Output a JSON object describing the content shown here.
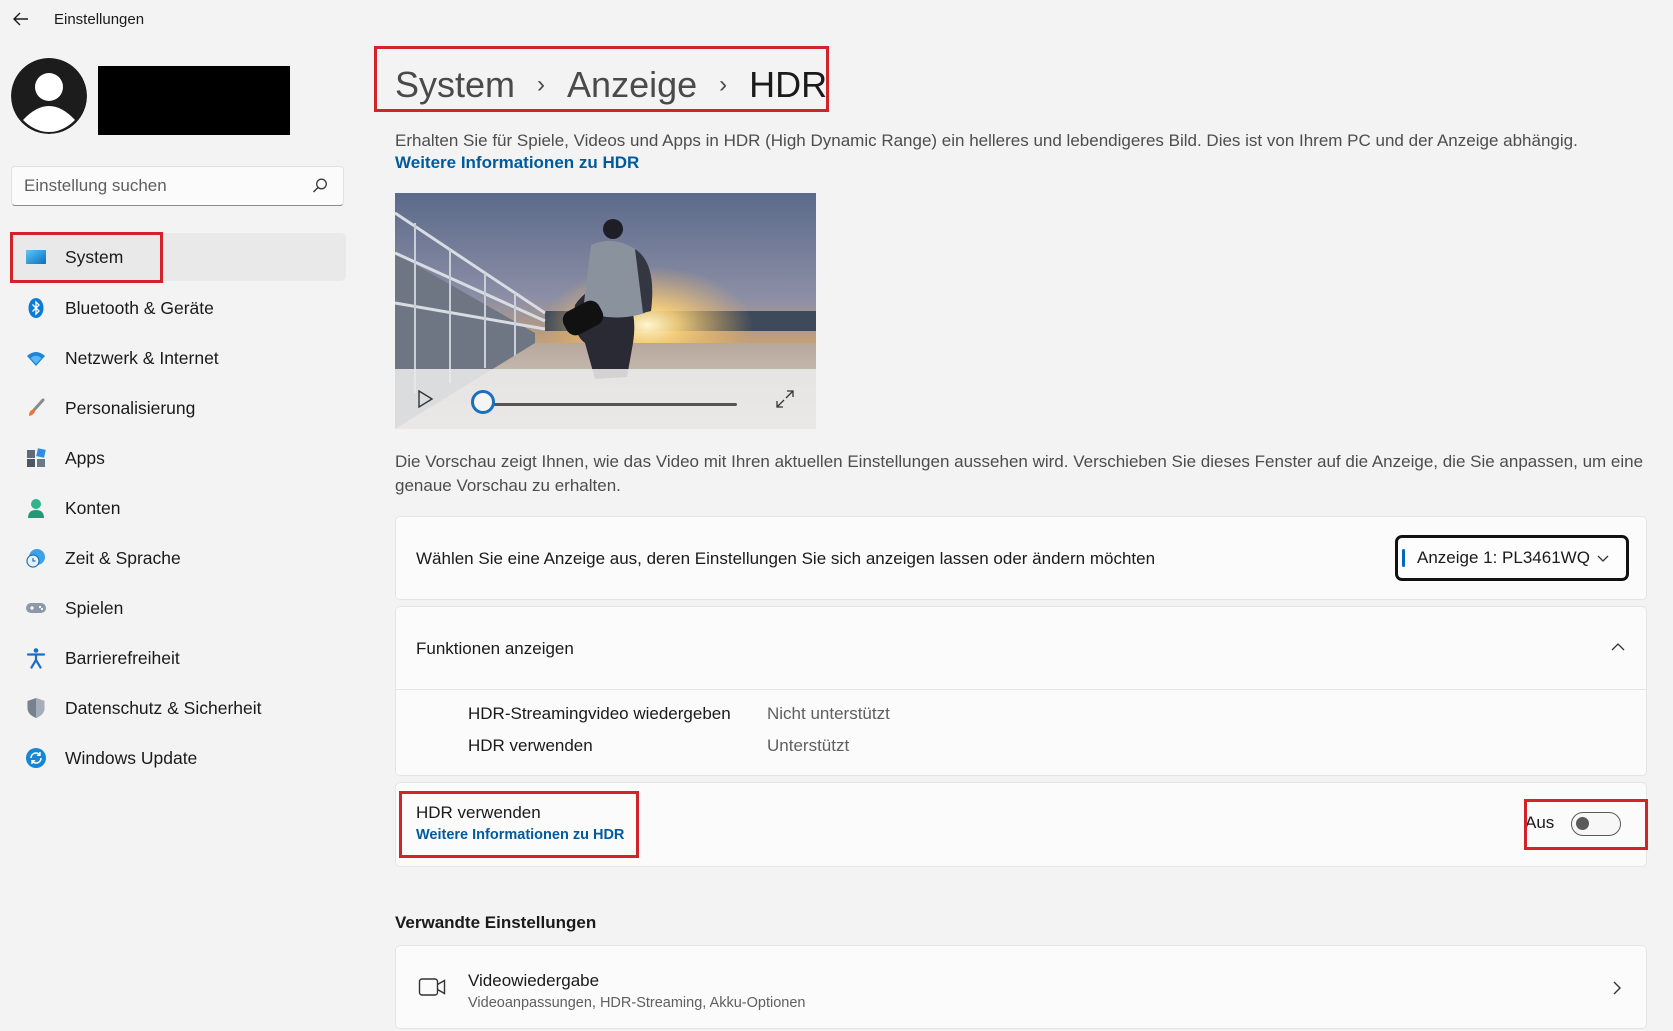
{
  "titlebar": {
    "app_title": "Einstellungen"
  },
  "sidebar": {
    "search_placeholder": "Einstellung suchen",
    "items": [
      {
        "label": "System",
        "icon": "monitor-icon",
        "active": true
      },
      {
        "label": "Bluetooth & Geräte",
        "icon": "bluetooth-icon"
      },
      {
        "label": "Netzwerk & Internet",
        "icon": "wifi-icon"
      },
      {
        "label": "Personalisierung",
        "icon": "paintbrush-icon"
      },
      {
        "label": "Apps",
        "icon": "apps-icon"
      },
      {
        "label": "Konten",
        "icon": "account-icon"
      },
      {
        "label": "Zeit & Sprache",
        "icon": "clock-globe-icon"
      },
      {
        "label": "Spielen",
        "icon": "gamepad-icon"
      },
      {
        "label": "Barrierefreiheit",
        "icon": "accessibility-icon"
      },
      {
        "label": "Datenschutz & Sicherheit",
        "icon": "shield-icon"
      },
      {
        "label": "Windows Update",
        "icon": "update-icon"
      }
    ]
  },
  "breadcrumb": {
    "level1": "System",
    "level2": "Anzeige",
    "current": "HDR"
  },
  "intro": {
    "description": "Erhalten Sie für Spiele, Videos und Apps in HDR (High Dynamic Range) ein helleres und lebendigeres Bild. Dies ist von Ihrem PC und der Anzeige abhängig.",
    "link": "Weitere Informationen zu HDR"
  },
  "video": {
    "progress": 0
  },
  "preview_note": "Die Vorschau zeigt Ihnen, wie das Video mit Ihren aktuellen Einstellungen aussehen wird. Verschieben Sie dieses Fenster auf die Anzeige, die Sie anpassen, um eine genaue Vorschau zu erhalten.",
  "display_select": {
    "label": "Wählen Sie eine Anzeige aus, deren Einstellungen Sie sich anzeigen lassen oder ändern möchten",
    "value": "Anzeige 1: PL3461WQ"
  },
  "features": {
    "title": "Funktionen anzeigen",
    "rows": [
      {
        "name": "HDR-Streamingvideo wiedergeben",
        "status": "Nicht unterstützt"
      },
      {
        "name": "HDR verwenden",
        "status": "Unterstützt"
      }
    ]
  },
  "hdr_toggle": {
    "title": "HDR verwenden",
    "link": "Weitere Informationen zu HDR",
    "state_label": "Aus",
    "on": false
  },
  "related": {
    "heading": "Verwandte Einstellungen",
    "items": [
      {
        "title": "Videowiedergabe",
        "subtitle": "Videoanpassungen, HDR-Streaming, Akku-Optionen",
        "icon": "video-camera-icon"
      }
    ]
  },
  "colors": {
    "accent": "#0067c0",
    "link": "#005a9e",
    "highlight": "#d2232a"
  }
}
